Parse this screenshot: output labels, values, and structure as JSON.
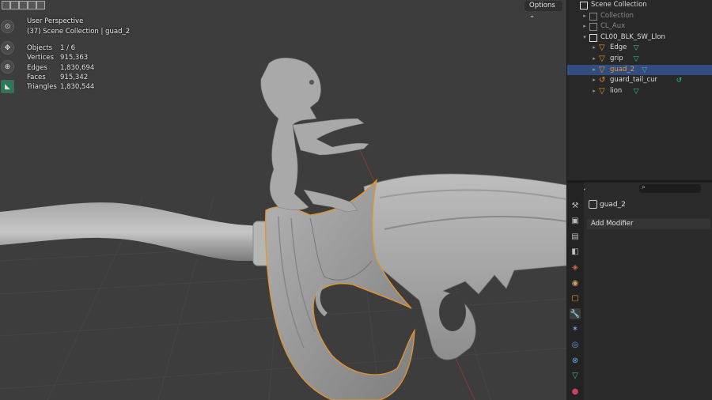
{
  "viewport": {
    "perspective": "User Perspective",
    "collection_info": "(37) Scene Collection | guad_2",
    "options_label": "Options",
    "stats": [
      {
        "label": "Objects",
        "value": "1 / 6"
      },
      {
        "label": "Vertices",
        "value": "915,363"
      },
      {
        "label": "Edges",
        "value": "1,830,694"
      },
      {
        "label": "Faces",
        "value": "915,342"
      },
      {
        "label": "Triangles",
        "value": "1,830,544"
      }
    ],
    "nav_icons": [
      "orbit-gizmo-icon",
      "move-view-icon",
      "zoom-view-icon",
      "camera-view-icon"
    ]
  },
  "outliner": {
    "rows": [
      {
        "name": "scene-collection",
        "label": "Scene Collection",
        "indent": 0,
        "icon": "collection",
        "selected": false,
        "dim": false
      },
      {
        "name": "collection",
        "label": "Collection",
        "indent": 1,
        "icon": "collection",
        "selected": false,
        "dim": true
      },
      {
        "name": "cl-aux",
        "label": "CL_Aux",
        "indent": 1,
        "icon": "collection",
        "selected": false,
        "dim": true
      },
      {
        "name": "cl00-blk-sw-llon",
        "label": "CL00_BLK_SW_Llon",
        "indent": 1,
        "icon": "collection",
        "selected": false,
        "dim": false
      },
      {
        "name": "edge",
        "label": "Edge",
        "indent": 2,
        "icon": "mesh",
        "selected": false,
        "dim": false
      },
      {
        "name": "grip",
        "label": "grip",
        "indent": 2,
        "icon": "mesh",
        "selected": false,
        "dim": false
      },
      {
        "name": "guad-2",
        "label": "guad_2",
        "indent": 2,
        "icon": "mesh",
        "selected": true,
        "dim": false
      },
      {
        "name": "guard-tail-cur",
        "label": "guard_tail_cur",
        "indent": 2,
        "icon": "curve",
        "selected": false,
        "dim": false
      },
      {
        "name": "lion",
        "label": "lion",
        "indent": 2,
        "icon": "mesh",
        "selected": false,
        "dim": false
      }
    ]
  },
  "properties": {
    "object_name": "guad_2",
    "add_modifier_label": "Add Modifier",
    "tabs": [
      "tool-icon",
      "render-icon",
      "output-icon",
      "view-layer-icon",
      "scene-icon",
      "world-icon",
      "object-icon",
      "modifier-icon",
      "particles-icon",
      "physics-icon",
      "constraints-icon",
      "data-icon",
      "material-icon"
    ]
  },
  "colors": {
    "selection_outline": "#e8922a",
    "mesh_icon": "#e8922a",
    "data_icon": "#35c2a0",
    "outliner_selected": "#334d80"
  }
}
